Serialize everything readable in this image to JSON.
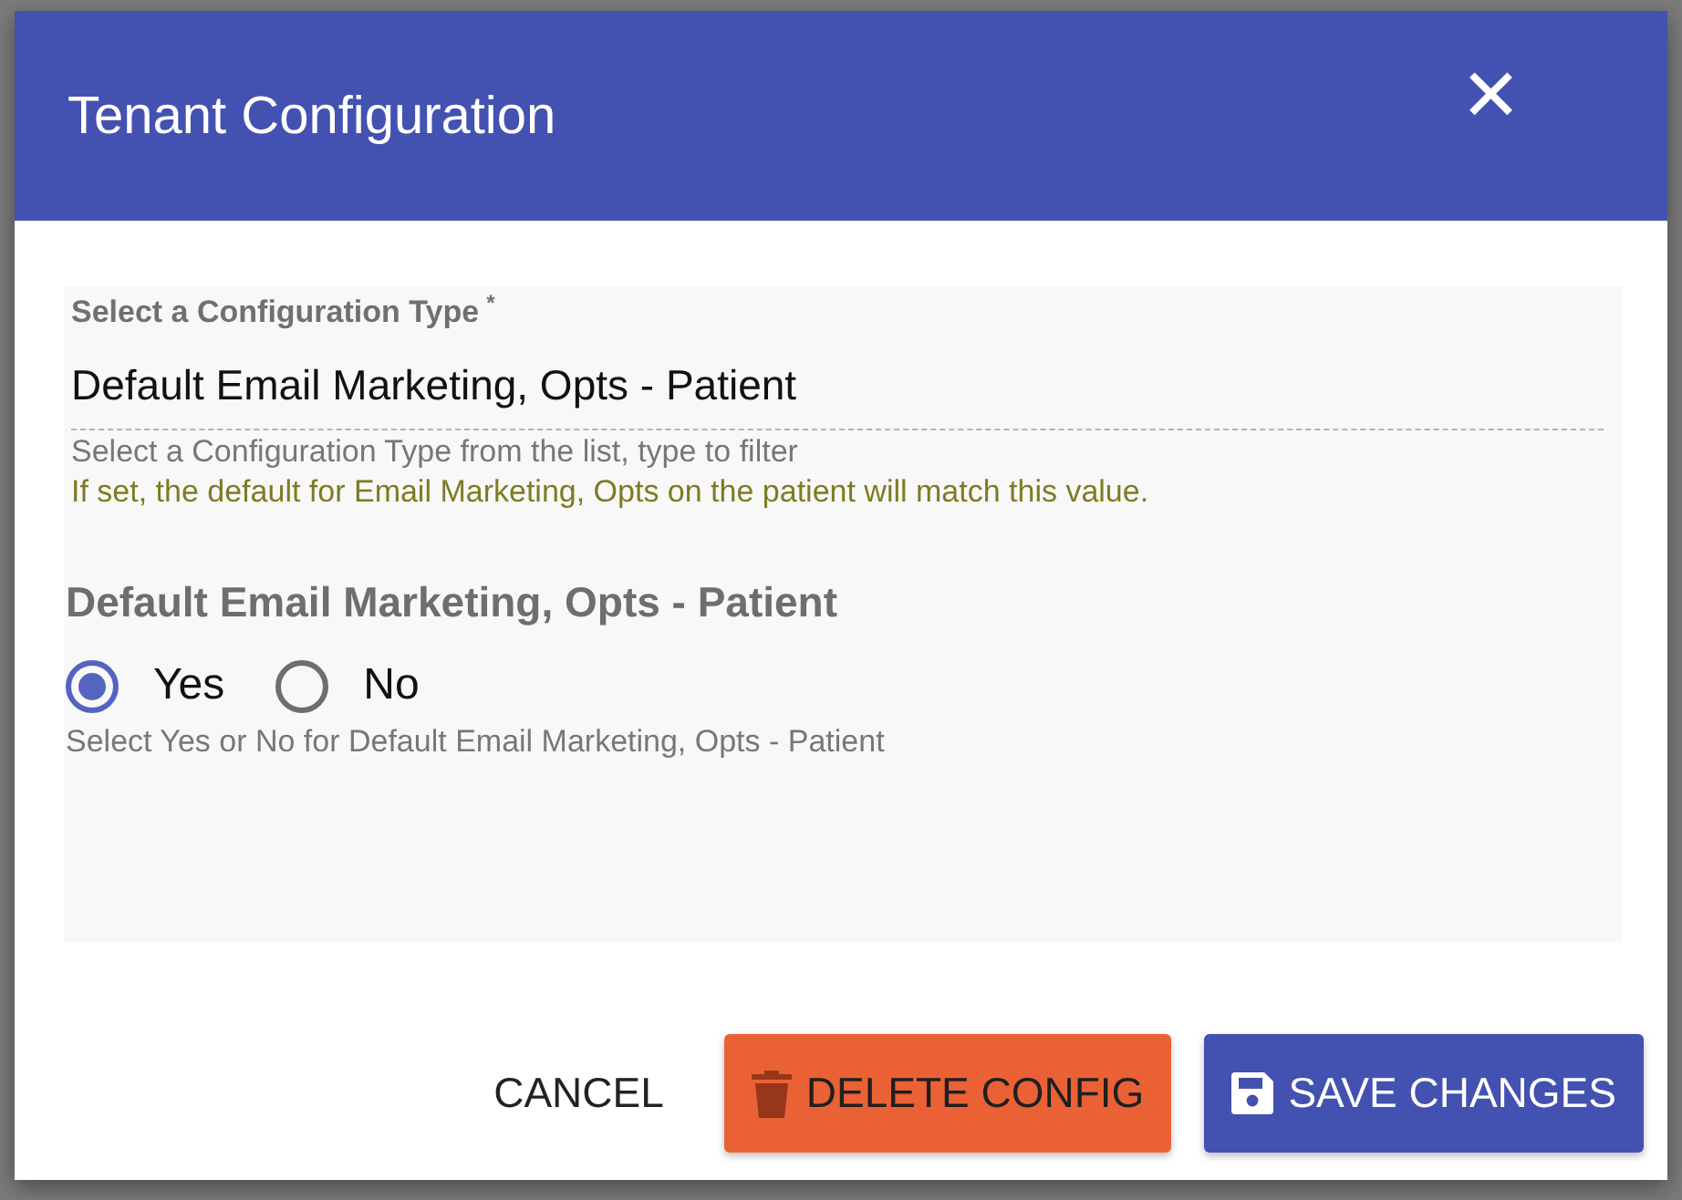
{
  "dialog": {
    "title": "Tenant Configuration",
    "close": "✕"
  },
  "config_type": {
    "label": "Select a Configuration Type",
    "required": "*",
    "value": "Default Email Marketing, Opts - Patient",
    "hint": "Select a Configuration Type from the list, type to filter",
    "note": "If set, the default for Email Marketing, Opts on the patient will match this value."
  },
  "setting": {
    "title": "Default Email Marketing, Opts - Patient",
    "options": [
      {
        "label": "Yes",
        "selected": true
      },
      {
        "label": "No",
        "selected": false
      }
    ],
    "hint": "Select Yes or No for Default Email Marketing, Opts - Patient"
  },
  "buttons": [
    {
      "kind": "text",
      "label": "CANCEL"
    },
    {
      "kind": "delete",
      "label": "DELETE CONFIG"
    },
    {
      "kind": "save",
      "label": "SAVE CHANGES"
    }
  ]
}
